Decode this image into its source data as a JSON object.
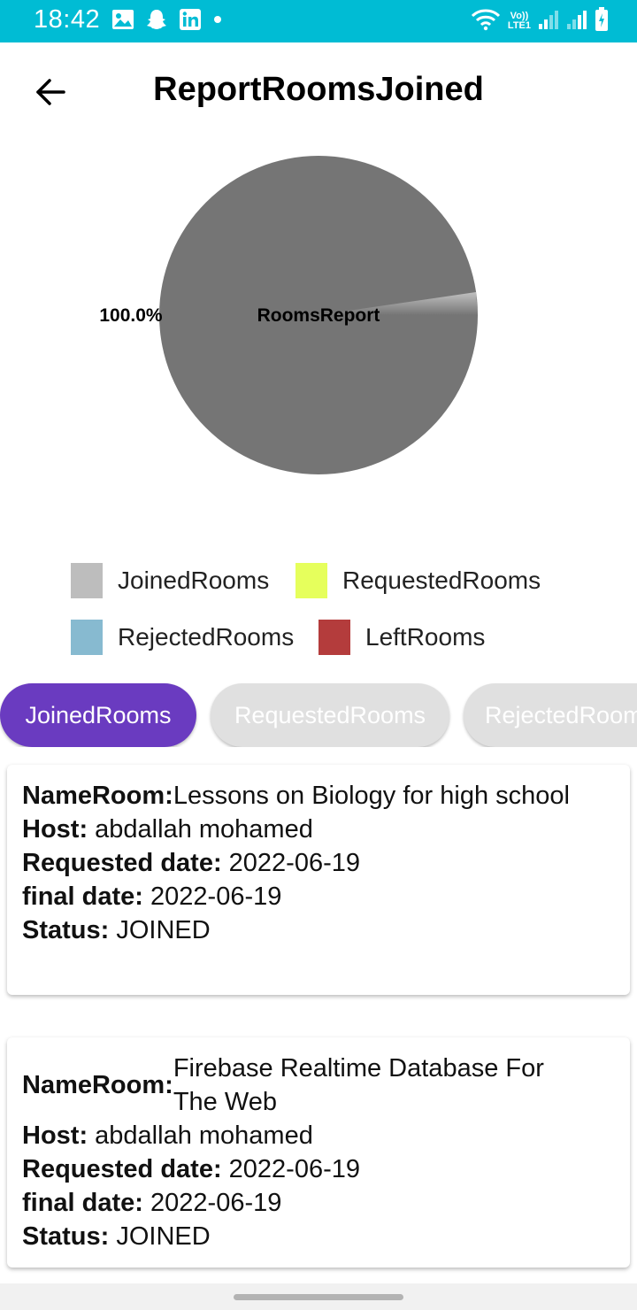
{
  "status_bar": {
    "time": "18:42",
    "left_icons": [
      "image-icon",
      "snapchat-icon",
      "linkedin-icon",
      "dot-icon"
    ],
    "right_icons": [
      "wifi-icon",
      "volte-lte-icon",
      "signal-1-icon",
      "signal-2-icon",
      "battery-icon"
    ],
    "lte_top": "Vo))",
    "lte_bottom": "LTE1",
    "background_color": "#00bcd4"
  },
  "header": {
    "title": "ReportRoomsJoined",
    "back_icon": "arrow-left-icon"
  },
  "chart_data": {
    "type": "pie",
    "title": "RoomsReport",
    "slices": [
      {
        "label": "JoinedRooms",
        "value": 100.0,
        "display": "100.0%",
        "color": "#757575"
      }
    ],
    "legend_position": "bottom"
  },
  "legend": {
    "items": [
      {
        "label": "JoinedRooms",
        "color": "#bdbdbd"
      },
      {
        "label": "RequestedRooms",
        "color": "#e6ff5c"
      },
      {
        "label": "RejectedRooms",
        "color": "#87bad0"
      },
      {
        "label": "LeftRooms",
        "color": "#b43c3c"
      }
    ]
  },
  "tabs": [
    {
      "label": "JoinedRooms",
      "active": true
    },
    {
      "label": "RequestedRooms",
      "active": false
    },
    {
      "label": "RejectedRooms",
      "active": false
    }
  ],
  "cards": [
    {
      "name_label": "NameRoom:",
      "name": "Lessons on Biology for high school",
      "host_label": "Host:",
      "host": "abdallah mohamed",
      "requested_label": "Requested date:",
      "requested_date": "2022-06-19",
      "final_label": "final date:",
      "final_date": "2022-06-19",
      "status_label": "Status:",
      "status": "JOINED"
    },
    {
      "name_label": "NameRoom:",
      "name": "Firebase Realtime Database For The Web",
      "host_label": "Host:",
      "host": "abdallah mohamed",
      "requested_label": "Requested date:",
      "requested_date": "2022-06-19",
      "final_label": "final date:",
      "final_date": "2022-06-19",
      "status_label": "Status:",
      "status": "JOINED"
    }
  ],
  "colors": {
    "accent": "#6a3bc0",
    "tab_inactive": "#e0e0e0"
  }
}
